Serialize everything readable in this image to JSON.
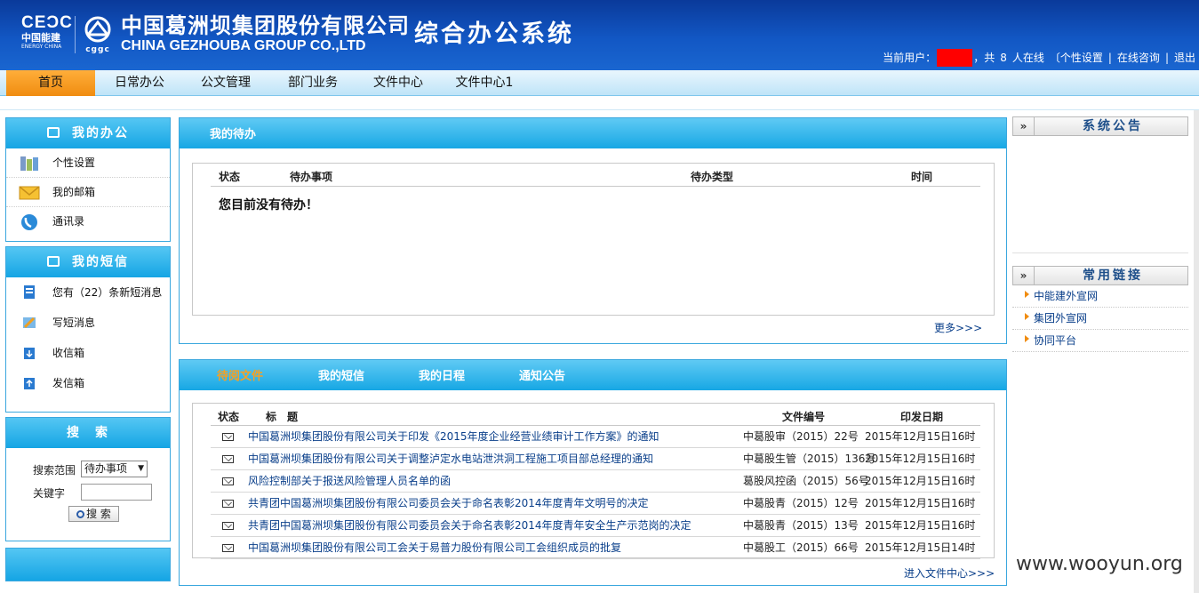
{
  "header": {
    "logo_cegc": "CEƆC",
    "logo_cegc_cn": "中国能建",
    "logo_cegc_en": "ENERGY CHINA",
    "logo_ggc": "cggc",
    "company_cn": "中国葛洲坝集团股份有限公司",
    "company_en": "CHINA GEZHOUBA GROUP CO.,LTD",
    "system_title": "综合办公系统",
    "current_user_label": "当前用户：",
    "online_text_pre": "，共",
    "online_count": "8",
    "online_text_post": "人在线",
    "links": [
      "〔个性设置",
      "在线咨询",
      "退出"
    ],
    "separator": "|"
  },
  "nav": {
    "items": [
      "首页",
      "日常办公",
      "公文管理",
      "部门业务",
      "文件中心",
      "文件中心1"
    ],
    "active_index": 0
  },
  "left": {
    "my_office": {
      "title": "我的办公",
      "items": [
        "个性设置",
        "我的邮箱",
        "通讯录"
      ]
    },
    "my_sms": {
      "title": "我的短信",
      "items": [
        "您有（22）条新短消息",
        "写短消息",
        "收信箱",
        "发信箱"
      ]
    },
    "search": {
      "title": "搜　索",
      "scope_label": "搜索范围",
      "scope_value": "待办事项",
      "keyword_label": "关键字",
      "keyword_value": "",
      "button": "搜 索"
    }
  },
  "todo": {
    "title": "我的待办",
    "columns": [
      "状态",
      "待办事项",
      "待办类型",
      "时间"
    ],
    "empty_message": "您目前没有待办！",
    "more": "更多>>>"
  },
  "docs": {
    "tabs": [
      "待阅文件",
      "我的短信",
      "我的日程",
      "通知公告"
    ],
    "active_tab": 0,
    "columns": [
      "状态",
      "标　题",
      "文件编号",
      "印发日期"
    ],
    "rows": [
      {
        "title": "中国葛洲坝集团股份有限公司关于印发《2015年度企业经营业绩审计工作方案》的通知",
        "number": "中葛股审（2015）22号",
        "date": "2015年12月15日16时"
      },
      {
        "title": "中国葛洲坝集团股份有限公司关于调整泸定水电站泄洪洞工程施工项目部总经理的通知",
        "number": "中葛股生管（2015）136号",
        "date": "2015年12月15日16时"
      },
      {
        "title": "风险控制部关于报送风险管理人员名单的函",
        "number": "葛股风控函（2015）56号",
        "date": "2015年12月15日16时"
      },
      {
        "title": "共青团中国葛洲坝集团股份有限公司委员会关于命名表彰2014年度青年文明号的决定",
        "number": "中葛股青（2015）12号",
        "date": "2015年12月15日16时"
      },
      {
        "title": "共青团中国葛洲坝集团股份有限公司委员会关于命名表彰2014年度青年安全生产示范岗的决定",
        "number": "中葛股青（2015）13号",
        "date": "2015年12月15日16时"
      },
      {
        "title": "中国葛洲坝集团股份有限公司工会关于易普力股份有限公司工会组织成员的批复",
        "number": "中葛股工（2015）66号",
        "date": "2015年12月15日14时"
      }
    ],
    "more": "进入文件中心>>>"
  },
  "right": {
    "announcement_title": "系统公告",
    "links_title": "常用链接",
    "arrow": "»",
    "links": [
      "中能建外宣网",
      "集团外宣网",
      "协同平台"
    ]
  },
  "watermark": "www.wooyun.org"
}
